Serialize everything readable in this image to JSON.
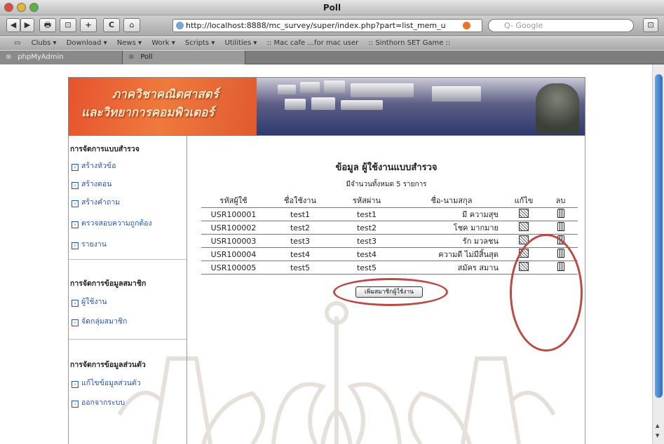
{
  "window": {
    "title": "Poll"
  },
  "toolbar": {
    "back": "◀",
    "forward": "▶",
    "print": "🖶",
    "readers": "⊡",
    "add": "+",
    "reload": "C",
    "home": "⌂",
    "url": "http://localhost:8888/mc_survey/super/index.php?part=list_mem_u",
    "search_placeholder": "Q- Google",
    "bookmarks_btn": "⊡"
  },
  "bookmarks": [
    "Clubs ▾",
    "Download ▾",
    "News ▾",
    "Work ▾",
    "Scripts ▾",
    "Utilities ▾",
    ":: Mac cafe ...for mac user",
    ":: Sinthorn SET Game ::"
  ],
  "tabs": [
    {
      "label": "phpMyAdmin"
    },
    {
      "label": "Poll"
    }
  ],
  "banner": {
    "line1": "ภาควิชาคณิตศาสตร์",
    "line2": "และวิทยาการคอมพิวเตอร์"
  },
  "sidebar": {
    "section1": {
      "heading": "การจัดการแบบสำรวจ",
      "items": [
        "สร้างหัวข้อ",
        "สร้างตอน",
        "สร้างคำถาม",
        "ตรวจสอบความถูกต้อง",
        "รายงาน"
      ]
    },
    "section2": {
      "heading": "การจัดการข้อมูลสมาชิก",
      "items": [
        "ผู้ใช้งาน",
        "จัดกลุ่มสมาชิก"
      ]
    },
    "section3": {
      "heading": "การจัดการข้อมูลส่วนตัว",
      "items": [
        "แก้ไขข้อมูลส่วนตัว",
        "ออกจากระบบ"
      ]
    }
  },
  "main": {
    "title": "ข้อมูล ผู้ใช้งานแบบสำรวจ",
    "count": "มีจำนวนทั้งหมด 5 รายการ",
    "headers": [
      "รหัสผู้ใช้",
      "ชื่อใช้งาน",
      "รหัสผ่าน",
      "ชื่อ-นามสกุล",
      "แก้ไข",
      "ลบ"
    ],
    "rows": [
      {
        "id": "USR100001",
        "username": "test1",
        "password": "test1",
        "fullname": "มี ความสุข"
      },
      {
        "id": "USR100002",
        "username": "test2",
        "password": "test2",
        "fullname": "โชค มากมาย"
      },
      {
        "id": "USR100003",
        "username": "test3",
        "password": "test3",
        "fullname": "รัก มวลชน"
      },
      {
        "id": "USR100004",
        "username": "test4",
        "password": "test4",
        "fullname": "ความดี ไม่มีสิ้นสุด"
      },
      {
        "id": "USR100005",
        "username": "test5",
        "password": "test5",
        "fullname": "สมัคร สมาน"
      }
    ],
    "add_button": "เพิ่มสมาชิกผู้ใช้งาน"
  },
  "colors": {
    "annotation": "#b84b47",
    "link": "#2a56a8",
    "banner": "#e6532e",
    "scroll_thumb": "#2a6fc4"
  }
}
